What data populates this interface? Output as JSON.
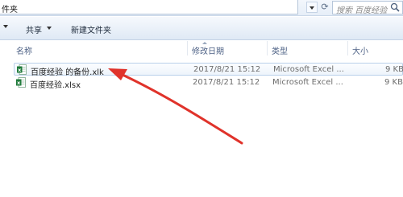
{
  "address": {
    "path_tail": "件夹"
  },
  "search": {
    "placeholder": "搜索 百度经验"
  },
  "toolbar": {
    "share_label": "共享",
    "new_folder_label": "新建文件夹"
  },
  "columns": {
    "name": "名称",
    "modified": "修改日期",
    "type": "类型",
    "size": "大小"
  },
  "files": [
    {
      "name": "百度经验 的备份.xlk",
      "modified": "2017/8/21 15:12",
      "type": "Microsoft Excel ...",
      "size": "9 KB",
      "icon": "excel-file-icon",
      "selected": true
    },
    {
      "name": "百度经验.xlsx",
      "modified": "2017/8/21 15:12",
      "type": "Microsoft Excel ...",
      "size": "9 KB",
      "icon": "excel-file-icon",
      "selected": false
    }
  ],
  "colors": {
    "toolbar_bg": "#dfe9f5",
    "header_text": "#4d6185",
    "arrow": "#e0332b",
    "selection_border": "#b9d0ea",
    "excel_green": "#1f7a3a"
  }
}
